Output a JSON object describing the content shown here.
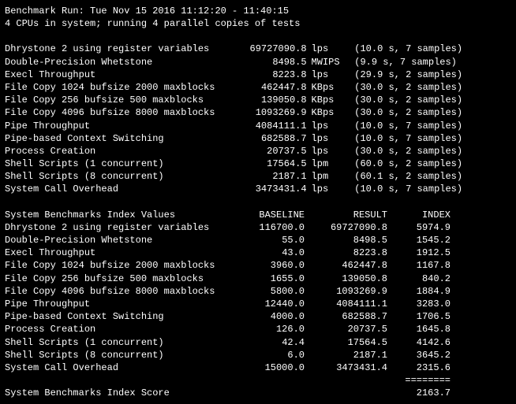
{
  "header": {
    "run_line": "Benchmark Run: Tue Nov 15 2016 11:12:20 - 11:40:15",
    "cpu_line": "4 CPUs in system; running 4 parallel copies of tests"
  },
  "results": [
    {
      "name": "Dhrystone 2 using register variables",
      "value": "69727090.8",
      "unit": "lps",
      "timing": "(10.0 s, 7 samples)"
    },
    {
      "name": "Double-Precision Whetstone",
      "value": "8498.5",
      "unit": "MWIPS",
      "timing": "(9.9 s, 7 samples)"
    },
    {
      "name": "Execl Throughput",
      "value": "8223.8",
      "unit": "lps",
      "timing": "(29.9 s, 2 samples)"
    },
    {
      "name": "File Copy 1024 bufsize 2000 maxblocks",
      "value": "462447.8",
      "unit": "KBps",
      "timing": "(30.0 s, 2 samples)"
    },
    {
      "name": "File Copy 256 bufsize 500 maxblocks",
      "value": "139050.8",
      "unit": "KBps",
      "timing": "(30.0 s, 2 samples)"
    },
    {
      "name": "File Copy 4096 bufsize 8000 maxblocks",
      "value": "1093269.9",
      "unit": "KBps",
      "timing": "(30.0 s, 2 samples)"
    },
    {
      "name": "Pipe Throughput",
      "value": "4084111.1",
      "unit": "lps",
      "timing": "(10.0 s, 7 samples)"
    },
    {
      "name": "Pipe-based Context Switching",
      "value": "682588.7",
      "unit": "lps",
      "timing": "(10.0 s, 7 samples)"
    },
    {
      "name": "Process Creation",
      "value": "20737.5",
      "unit": "lps",
      "timing": "(30.0 s, 2 samples)"
    },
    {
      "name": "Shell Scripts (1 concurrent)",
      "value": "17564.5",
      "unit": "lpm",
      "timing": "(60.0 s, 2 samples)"
    },
    {
      "name": "Shell Scripts (8 concurrent)",
      "value": "2187.1",
      "unit": "lpm",
      "timing": "(60.1 s, 2 samples)"
    },
    {
      "name": "System Call Overhead",
      "value": "3473431.4",
      "unit": "lps",
      "timing": "(10.0 s, 7 samples)"
    }
  ],
  "index_header": {
    "title": "System Benchmarks Index Values",
    "h_base": "BASELINE",
    "h_res": "RESULT",
    "h_idx": "INDEX"
  },
  "index": [
    {
      "name": "Dhrystone 2 using register variables",
      "baseline": "116700.0",
      "result": "69727090.8",
      "index": "5974.9"
    },
    {
      "name": "Double-Precision Whetstone",
      "baseline": "55.0",
      "result": "8498.5",
      "index": "1545.2"
    },
    {
      "name": "Execl Throughput",
      "baseline": "43.0",
      "result": "8223.8",
      "index": "1912.5"
    },
    {
      "name": "File Copy 1024 bufsize 2000 maxblocks",
      "baseline": "3960.0",
      "result": "462447.8",
      "index": "1167.8"
    },
    {
      "name": "File Copy 256 bufsize 500 maxblocks",
      "baseline": "1655.0",
      "result": "139050.8",
      "index": "840.2"
    },
    {
      "name": "File Copy 4096 bufsize 8000 maxblocks",
      "baseline": "5800.0",
      "result": "1093269.9",
      "index": "1884.9"
    },
    {
      "name": "Pipe Throughput",
      "baseline": "12440.0",
      "result": "4084111.1",
      "index": "3283.0"
    },
    {
      "name": "Pipe-based Context Switching",
      "baseline": "4000.0",
      "result": "682588.7",
      "index": "1706.5"
    },
    {
      "name": "Process Creation",
      "baseline": "126.0",
      "result": "20737.5",
      "index": "1645.8"
    },
    {
      "name": "Shell Scripts (1 concurrent)",
      "baseline": "42.4",
      "result": "17564.5",
      "index": "4142.6"
    },
    {
      "name": "Shell Scripts (8 concurrent)",
      "baseline": "6.0",
      "result": "2187.1",
      "index": "3645.2"
    },
    {
      "name": "System Call Overhead",
      "baseline": "15000.0",
      "result": "3473431.4",
      "index": "2315.6"
    }
  ],
  "footer": {
    "divider": "========",
    "score_label": "System Benchmarks Index Score",
    "score_value": "2163.7"
  }
}
